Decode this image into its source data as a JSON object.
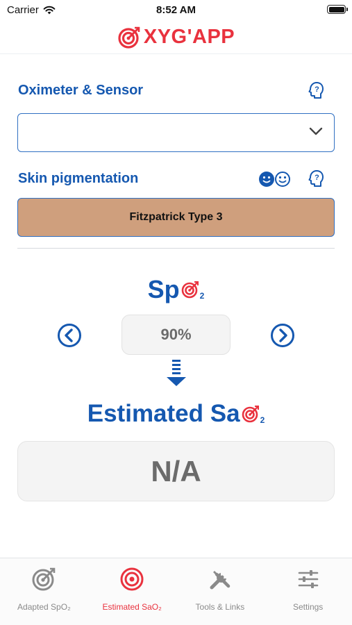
{
  "status_bar": {
    "carrier": "Carrier",
    "time": "8:52 AM"
  },
  "header": {
    "app_name": "XYG'APP",
    "brand_color": "#e9323e"
  },
  "oximeter": {
    "label": "Oximeter & Sensor",
    "selected_value": ""
  },
  "skin": {
    "label": "Skin pigmentation",
    "selected_value": "Fitzpatrick Type 3",
    "swatch_color": "#cf9f7d"
  },
  "spo2": {
    "title": "Sp",
    "subscript": "2",
    "value": "90%"
  },
  "estimated": {
    "title": "Estimated Sa",
    "subscript": "2",
    "value": "N/A"
  },
  "tabs": [
    {
      "label": "Adapted SpO₂",
      "icon": "target-arrow-icon",
      "active": false
    },
    {
      "label": "Estimated SaO₂",
      "icon": "target-icon",
      "active": true
    },
    {
      "label": "Tools & Links",
      "icon": "tools-icon",
      "active": false
    },
    {
      "label": "Settings",
      "icon": "sliders-icon",
      "active": false
    }
  ],
  "colors": {
    "primary_blue": "#1558b0",
    "accent_red": "#e9323e"
  }
}
